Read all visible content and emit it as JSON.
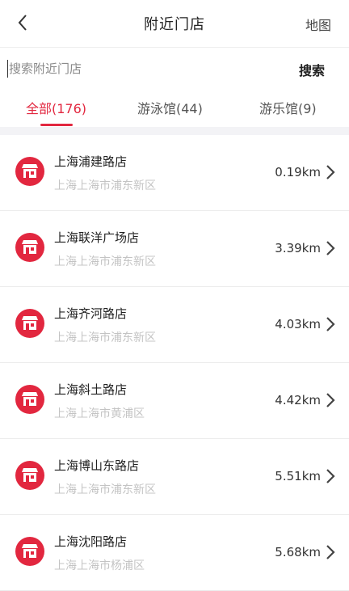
{
  "header": {
    "title": "附近门店",
    "map_label": "地图"
  },
  "search": {
    "placeholder": "搜索附近门店",
    "value": "",
    "button_label": "搜索"
  },
  "tabs": [
    {
      "label": "全部(176)",
      "active": true
    },
    {
      "label": "游泳馆(44)",
      "active": false
    },
    {
      "label": "游乐馆(9)",
      "active": false
    }
  ],
  "stores": [
    {
      "name": "上海浦建路店",
      "address": "上海上海市浦东新区",
      "distance": "0.19km"
    },
    {
      "name": "上海联洋广场店",
      "address": "上海上海市浦东新区",
      "distance": "3.39km"
    },
    {
      "name": "上海齐河路店",
      "address": "上海上海市浦东新区",
      "distance": "4.03km"
    },
    {
      "name": "上海斜土路店",
      "address": "上海上海市黄浦区",
      "distance": "4.42km"
    },
    {
      "name": "上海博山东路店",
      "address": "上海上海市浦东新区",
      "distance": "5.51km"
    },
    {
      "name": "上海沈阳路店",
      "address": "上海上海市杨浦区",
      "distance": "5.68km"
    }
  ],
  "icons": {
    "back": "chevron-left-icon",
    "store": "store-icon",
    "row_arrow": "chevron-right-icon"
  },
  "colors": {
    "accent": "#e2273f",
    "muted_text": "#c4c4c4",
    "section_bg": "#f3f3f6"
  }
}
